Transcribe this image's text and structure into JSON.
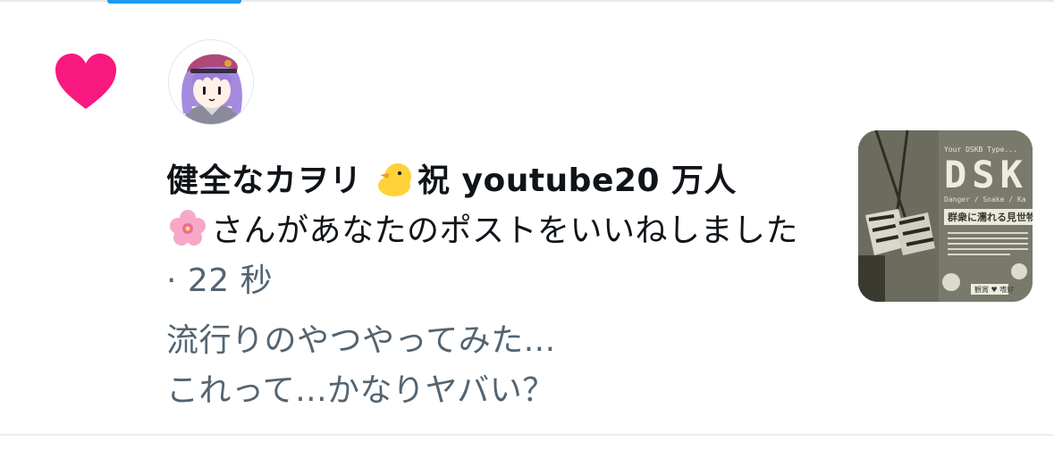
{
  "notification": {
    "type_icon": "heart-icon",
    "accent_color": "#f91880",
    "user_name": "健全なカヲリ",
    "name_suffix": "祝 youtube20 万人",
    "action_text": "さんがあなたのポストをいいねしました",
    "meta": " · 22 秒",
    "excerpt_lines": [
      "流行りのやつやってみた...",
      "これって...かなりヤバい？"
    ]
  },
  "thumbnail": {
    "header_small": "Your DSKB Type...",
    "big_text": "DSK",
    "subtitle": "Danger / Snake / Ka",
    "heading": "群衆に濡れる見世物",
    "badge": "観賞 ♥ 嗜好"
  },
  "colors": {
    "primary_text": "#0f1419",
    "secondary_text": "#536471",
    "tab_indicator": "#1d9bf0",
    "divider": "#e6e9ec"
  }
}
